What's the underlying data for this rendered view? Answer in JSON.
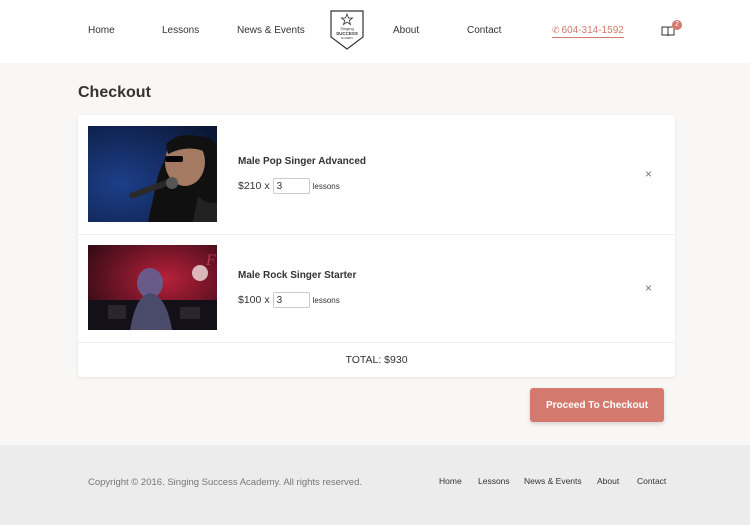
{
  "nav": {
    "home": "Home",
    "lessons": "Lessons",
    "news_events": "News & Events",
    "about": "About",
    "contact": "Contact"
  },
  "logo": {
    "line1": "Singing",
    "line2": "SUCCESS",
    "line3": "ACADEMY"
  },
  "phone": "604-314-1592",
  "cart_count": "2",
  "page_title": "Checkout",
  "items": [
    {
      "name": "Male Pop Singer Advanced",
      "price": "$210",
      "multiplier": "x",
      "quantity": "3",
      "unit": "lessons",
      "remove": "×"
    },
    {
      "name": "Male Rock Singer Starter",
      "price": "$100",
      "multiplier": "x",
      "quantity": "3",
      "unit": "lessons",
      "remove": "×"
    }
  ],
  "total": "TOTAL: $930",
  "checkout_button": "Proceed To Checkout",
  "footer": {
    "copyright": "Copyright © 2016. Singing Success Academy. All rights reserved.",
    "home": "Home",
    "lessons": "Lessons",
    "news_events": "News & Events",
    "about": "About",
    "contact": "Contact"
  },
  "colors": {
    "accent": "#d4796d",
    "page_bg": "#f8f7f5",
    "footer_bg": "#ececec"
  }
}
